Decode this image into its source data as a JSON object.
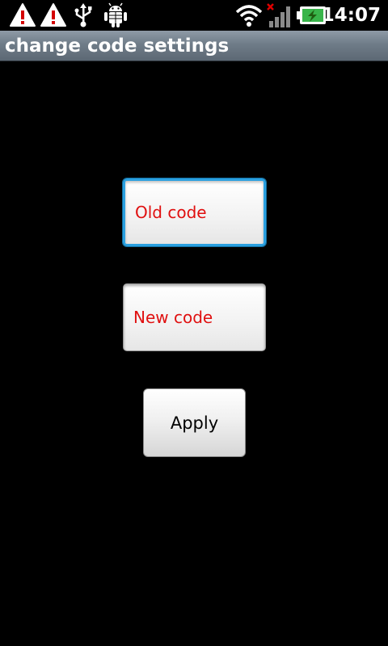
{
  "status_bar": {
    "icons": [
      "warning-icon",
      "warning-icon",
      "usb-icon",
      "android-debug-icon",
      "wifi-icon",
      "signal-no-data-icon",
      "battery-charging-icon"
    ],
    "time": "14:07"
  },
  "title_bar": {
    "title": "change code settings"
  },
  "form": {
    "old_code_placeholder": "Old code",
    "new_code_placeholder": "New code",
    "apply_label": "Apply"
  },
  "colors": {
    "background": "#000000",
    "title_bar": "#6f7c88",
    "placeholder_text": "#e01010",
    "focus_border": "#2aa0e0"
  }
}
